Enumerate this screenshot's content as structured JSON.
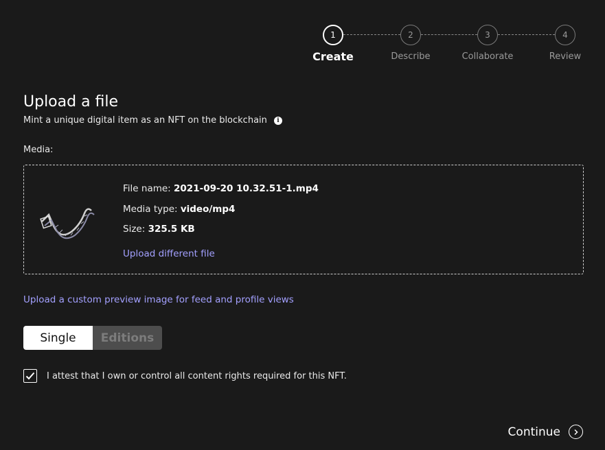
{
  "stepper": {
    "steps": [
      {
        "number": "1",
        "label": "Create",
        "active": true
      },
      {
        "number": "2",
        "label": "Describe",
        "active": false
      },
      {
        "number": "3",
        "label": "Collaborate",
        "active": false
      },
      {
        "number": "4",
        "label": "Review",
        "active": false
      }
    ]
  },
  "header": {
    "title": "Upload a file",
    "subtitle": "Mint a unique digital item as an NFT on the blockchain",
    "info_icon": "info-icon"
  },
  "media": {
    "label": "Media:",
    "file_name_label": "File name:",
    "file_name": "2021-09-20 10.32.51-1.mp4",
    "media_type_label": "Media type:",
    "media_type": "video/mp4",
    "size_label": "Size:",
    "size": "325.5 KB",
    "upload_different": "Upload different file",
    "thumbnail_icon": "film-strip-icon"
  },
  "custom_preview_link": "Upload a custom preview image for feed and profile views",
  "edition_toggle": {
    "options": [
      "Single",
      "Editions"
    ],
    "selected": "Single"
  },
  "attest": {
    "checked": true,
    "text": "I attest that I own or control all content rights required for this NFT."
  },
  "footer": {
    "continue_label": "Continue",
    "continue_icon": "arrow-right-circle-icon"
  },
  "colors": {
    "background": "#1a1a1a",
    "link": "#a3a0ff",
    "toggle_active_bg": "#ffffff",
    "toggle_inactive_bg": "#4d4d4d"
  }
}
